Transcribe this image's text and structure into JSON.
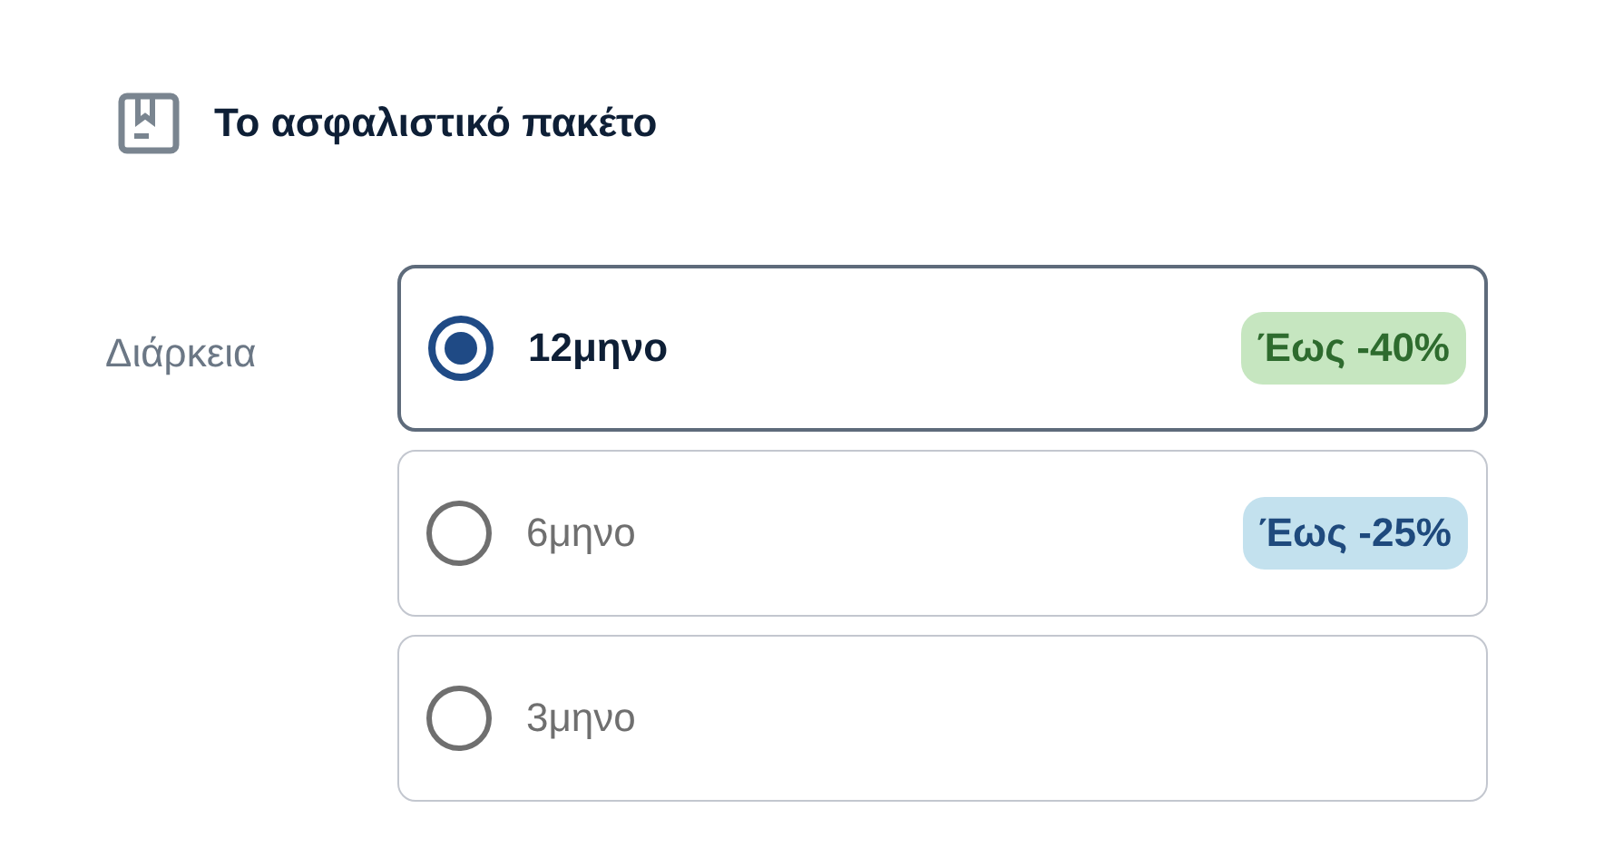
{
  "section": {
    "title": "Το ασφαλιστικό πακέτο"
  },
  "duration": {
    "label": "Διάρκεια",
    "options": [
      {
        "label": "12μηνο",
        "selected": true,
        "badge": {
          "text": "Έως -40%",
          "kind": "success"
        }
      },
      {
        "label": "6μηνο",
        "selected": false,
        "badge": {
          "text": "Έως -25%",
          "kind": "info"
        }
      },
      {
        "label": "3μηνο",
        "selected": false
      }
    ]
  }
}
